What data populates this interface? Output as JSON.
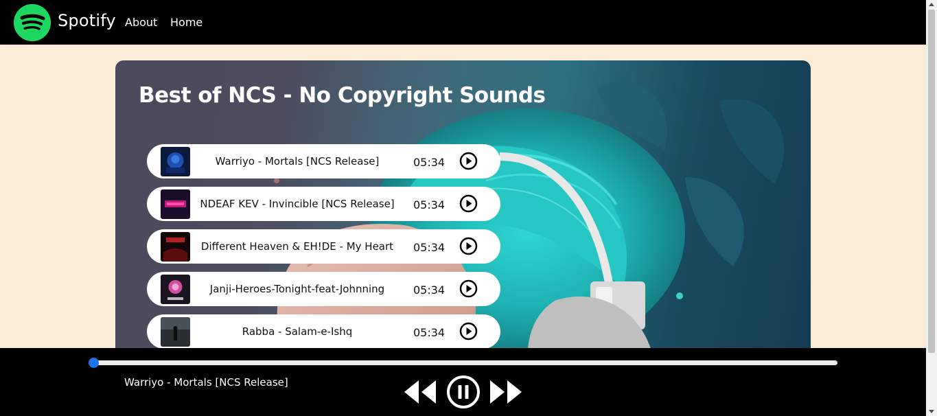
{
  "navbar": {
    "brand": "Spotify",
    "links": [
      "About",
      "Home"
    ],
    "logo_color": "#1ed760"
  },
  "playlist": {
    "title": "Best of NCS - No Copyright Sounds",
    "songs": [
      {
        "name": "Warriyo - Mortals [NCS Release]",
        "duration": "05:34",
        "cover_icon": "cover-warriyo"
      },
      {
        "name": "NDEAF KEV - Invincible [NCS Release]",
        "duration": "05:34",
        "cover_icon": "cover-invincible"
      },
      {
        "name": "Different Heaven & EH!DE - My Heart",
        "duration": "05:34",
        "cover_icon": "cover-my-heart"
      },
      {
        "name": "Janji-Heroes-Tonight-feat-Johnning",
        "duration": "05:34",
        "cover_icon": "cover-heroes"
      },
      {
        "name": "Rabba - Salam-e-Ishq",
        "duration": "05:34",
        "cover_icon": "cover-rabba"
      }
    ]
  },
  "player": {
    "now_playing": "Warriyo - Mortals [NCS Release]",
    "progress": 0,
    "state": "playing",
    "accent_color": "#1a73e8"
  }
}
